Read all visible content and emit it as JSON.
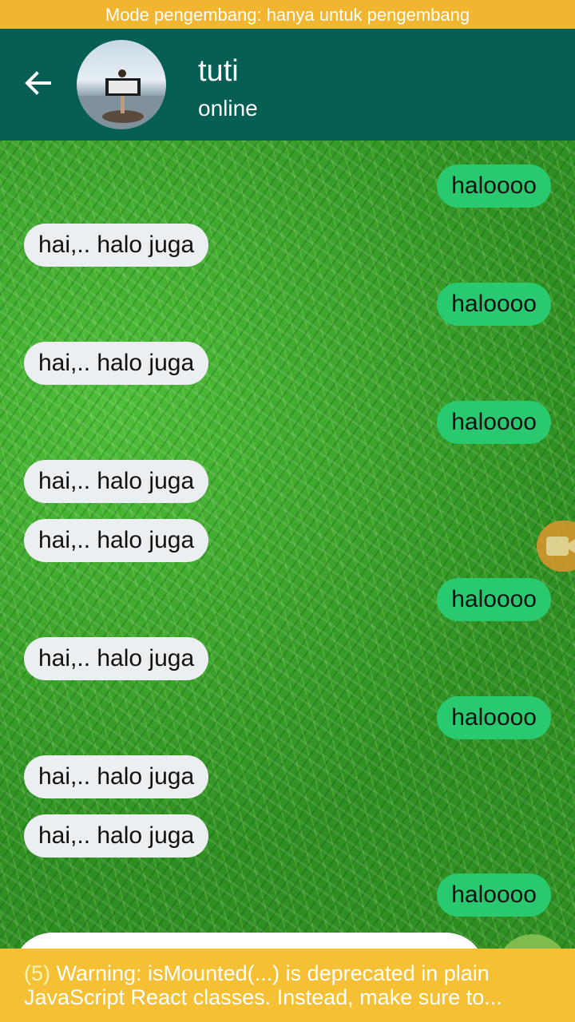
{
  "dev_banner": "Mode pengembang: hanya untuk pengembang",
  "contact": {
    "name": "tuti",
    "status": "online"
  },
  "messages": [
    {
      "from": "me",
      "text": "haloooo"
    },
    {
      "from": "them",
      "text": "hai,.. halo juga"
    },
    {
      "from": "me",
      "text": "haloooo"
    },
    {
      "from": "them",
      "text": "hai,.. halo juga"
    },
    {
      "from": "me",
      "text": "haloooo"
    },
    {
      "from": "them",
      "text": "hai,.. halo juga"
    },
    {
      "from": "them",
      "text": "hai,.. halo juga"
    },
    {
      "from": "me",
      "text": "haloooo"
    },
    {
      "from": "them",
      "text": "hai,.. halo juga"
    },
    {
      "from": "me",
      "text": "haloooo"
    },
    {
      "from": "them",
      "text": "hai,.. halo juga"
    },
    {
      "from": "them",
      "text": "hai,.. halo juga"
    },
    {
      "from": "me",
      "text": "haloooo"
    }
  ],
  "warning": {
    "count": "(5)",
    "line1": " Warning: isMounted(...) is deprecated in plain",
    "line2": "JavaScript React classes. Instead, make sure to..."
  },
  "icons": {
    "back": "arrow-left",
    "video": "video-camera",
    "send": "send"
  },
  "colors": {
    "header": "#075e54",
    "my_bubble": "#28c96f",
    "their_bubble": "#eceff1",
    "warning": "#f6c034"
  }
}
